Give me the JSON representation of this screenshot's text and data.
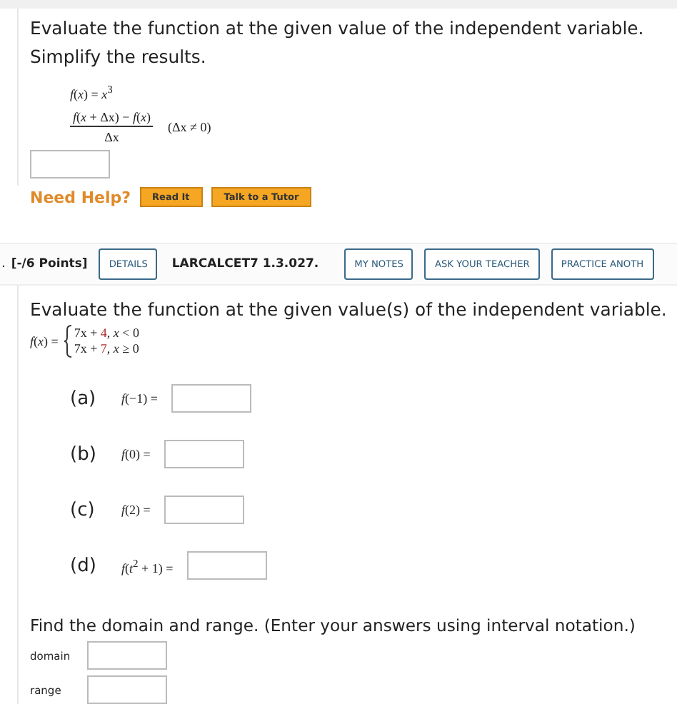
{
  "question1": {
    "prompt": "Evaluate the function at the given value of the independent variable. Simplify the results.",
    "function": "*f*(*x*) = *x*$^{3}$",
    "numerator": "*f*(*x* + Δx) − *f*(*x*)",
    "denominator": "Δx",
    "condition": "(Δx ≠ 0)",
    "need_help": "Need Help?",
    "help_buttons": [
      "Read It",
      "Talk to a Tutor"
    ]
  },
  "question2": {
    "question_number": ".",
    "points": "[-/6 Points]",
    "details_button": "DETAILS",
    "reference": "LARCALCET7 1.3.027.",
    "header_buttons": [
      "MY NOTES",
      "ASK YOUR TEACHER",
      "PRACTICE ANOTH"
    ],
    "prompt": "Evaluate the function at the given value(s) of the independent variable.",
    "function_name": "*f*(*x*) =",
    "pieces": [
      {
        "term": "7x + ",
        "constant": "4",
        "condition": ", *x* < 0"
      },
      {
        "term": "7x + ",
        "constant": "7",
        "condition": ", *x* ≥ 0"
      }
    ],
    "parts": [
      {
        "label": "(a)",
        "expression": "*f*(−1) ="
      },
      {
        "label": "(b)",
        "expression": "*f*(0) ="
      },
      {
        "label": "(c)",
        "expression": "*f*(2) ="
      },
      {
        "label": "(d)",
        "expression": "*f*(*t*$^{2}$ + 1) ="
      }
    ],
    "domain_prompt": "Find the domain and range. (Enter your answers using interval notation.)",
    "fields": [
      "domain",
      "range"
    ]
  }
}
